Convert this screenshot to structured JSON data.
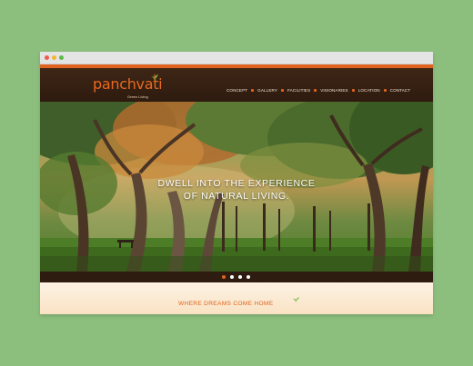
{
  "site": {
    "logo": "panchvati",
    "tagline": "Green Living"
  },
  "nav": {
    "items": [
      "CONCEPT",
      "GALLERY",
      "FACILITIES",
      "VISIONARIES",
      "LOCATION",
      "CONTACT"
    ]
  },
  "hero": {
    "headline_line1": "DWELL INTO THE EXPERIENCE",
    "headline_line2": "OF NATURAL LIVING."
  },
  "slider": {
    "count": 4,
    "active_index": 0
  },
  "section": {
    "title": "WHERE DREAMS COME HOME"
  },
  "colors": {
    "accent": "#e0641d",
    "header": "#3e2616",
    "page_bg": "#8cbf7e",
    "leaf": "#5aa83a"
  },
  "icons": [
    "leaf-icon"
  ]
}
